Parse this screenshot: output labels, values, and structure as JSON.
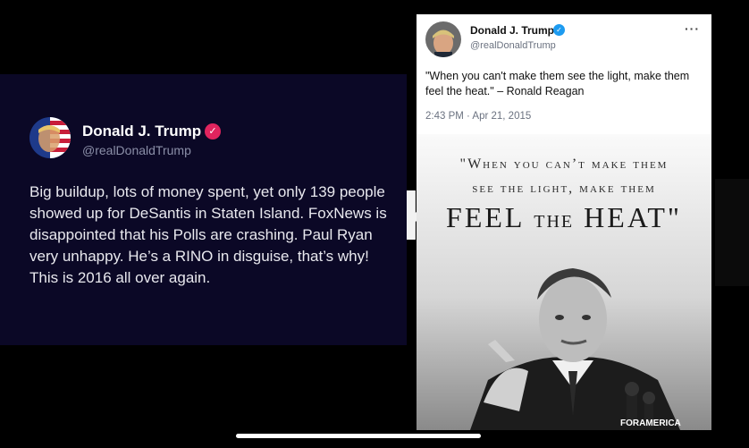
{
  "left_tweet": {
    "name": "Donald J. Trump",
    "handle": "@realDonaldTrump",
    "badge_icon": "verified-check-icon",
    "badge_color": "#e0245e",
    "body": "Big buildup, lots of money spent, yet only 139 people showed up for DeSantis in Staten Island. FoxNews is disappointed that his Polls are crashing. Paul Ryan very unhappy. He’s a RINO in disguise, that’s why! This is 2016 all over again."
  },
  "right_tweet": {
    "name": "Donald J. Trump",
    "handle": "@realDonaldTrump",
    "badge_icon": "verified-check-icon",
    "badge_color": "#1d9bf0",
    "more_label": "···",
    "text": "\"When you can't make them see the light, make them feel the heat.\" – Ronald Reagan",
    "timestamp": "2:43 PM · Apr 21, 2015",
    "image": {
      "line1": "\"When you can’t make them",
      "line2": "see the light, make them",
      "line3_a": "FEEL",
      "line3_b": "THE",
      "line3_c": "HEAT\"",
      "watermark": "FORAMERICA"
    }
  }
}
